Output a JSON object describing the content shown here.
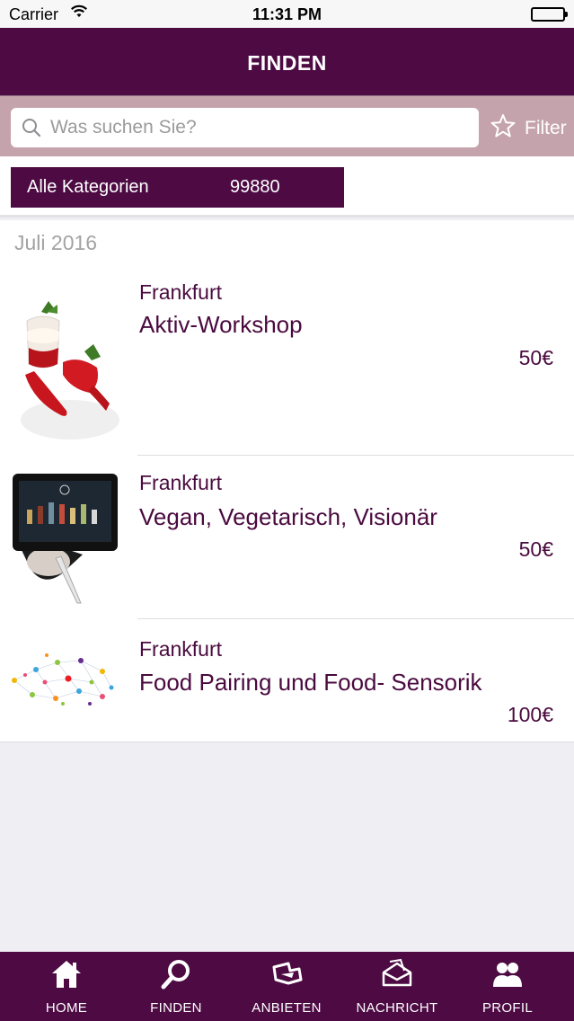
{
  "status_bar": {
    "carrier": "Carrier",
    "time": "11:31 PM"
  },
  "nav": {
    "title": "FINDEN"
  },
  "search": {
    "placeholder": "Was suchen Sie?",
    "value": "",
    "filter_label": "Filter"
  },
  "category": {
    "label": "Alle Kategorien",
    "count": "99880"
  },
  "list": {
    "section": "Juli 2016",
    "items": [
      {
        "city": "Frankfurt",
        "title": "Aktiv-Workshop",
        "price": "50€",
        "image": "dessert-glass-strawberries"
      },
      {
        "city": "Frankfurt",
        "title": "Vegan, Vegetarisch, Visionär",
        "price": "50€",
        "image": "tablet-with-spoon"
      },
      {
        "city": "Frankfurt",
        "title": "Food Pairing und Food- Sensorik",
        "price": "100€",
        "image": "colorful-network-graph"
      }
    ]
  },
  "tabbar": {
    "tabs": [
      {
        "label": "HOME",
        "icon": "home-icon"
      },
      {
        "label": "FINDEN",
        "icon": "search-icon"
      },
      {
        "label": "ANBIETEN",
        "icon": "offer-icon"
      },
      {
        "label": "NACHRICHT",
        "icon": "message-icon"
      },
      {
        "label": "PROFIL",
        "icon": "profile-icon"
      }
    ]
  },
  "colors": {
    "brand": "#4d0a43",
    "search_bg": "#c5a3ac",
    "background": "#efeef3"
  }
}
